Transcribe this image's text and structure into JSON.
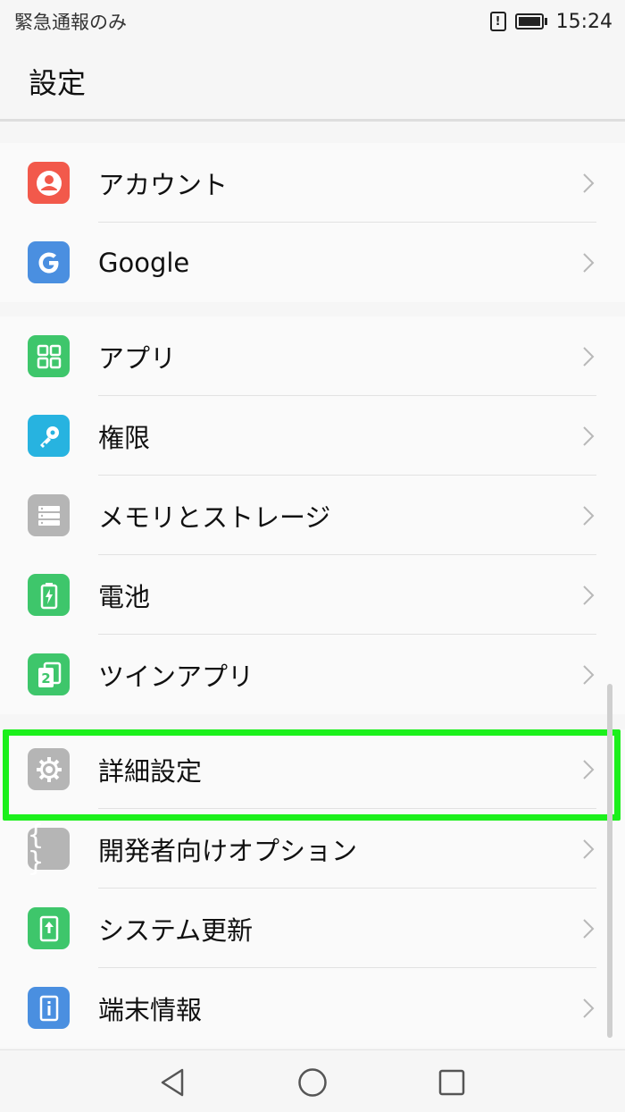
{
  "status_bar": {
    "carrier_text": "緊急通報のみ",
    "time": "15:24",
    "icons": [
      "sim-alert-icon",
      "battery-icon"
    ]
  },
  "app_bar": {
    "title": "設定"
  },
  "groups": [
    {
      "items": [
        {
          "label": "アカウント",
          "icon": "account-icon",
          "color": "#f2594b"
        },
        {
          "label": "Google",
          "icon": "google-icon",
          "color": "#4a8fe0"
        }
      ]
    },
    {
      "items": [
        {
          "label": "アプリ",
          "icon": "apps-grid-icon",
          "color": "#3ec66b"
        },
        {
          "label": "権限",
          "icon": "key-icon",
          "color": "#27b3e0"
        },
        {
          "label": "メモリとストレージ",
          "icon": "storage-icon",
          "color": "#b5b5b5"
        },
        {
          "label": "電池",
          "icon": "battery-icon",
          "color": "#3ec66b"
        },
        {
          "label": "ツインアプリ",
          "icon": "twin-apps-icon",
          "color": "#3ec66b"
        }
      ]
    },
    {
      "items": [
        {
          "label": "詳細設定",
          "icon": "gear-icon",
          "color": "#b5b5b5",
          "highlighted": true
        },
        {
          "label": "開発者向けオプション",
          "icon": "braces-icon",
          "color": "#b5b5b5"
        },
        {
          "label": "システム更新",
          "icon": "system-update-icon",
          "color": "#3ec66b"
        },
        {
          "label": "端末情報",
          "icon": "info-icon",
          "color": "#4a8fe0"
        }
      ]
    }
  ],
  "highlight_color": "#1cf01c",
  "nav_bar": {
    "buttons": [
      "back-icon",
      "home-icon",
      "recents-icon"
    ]
  }
}
